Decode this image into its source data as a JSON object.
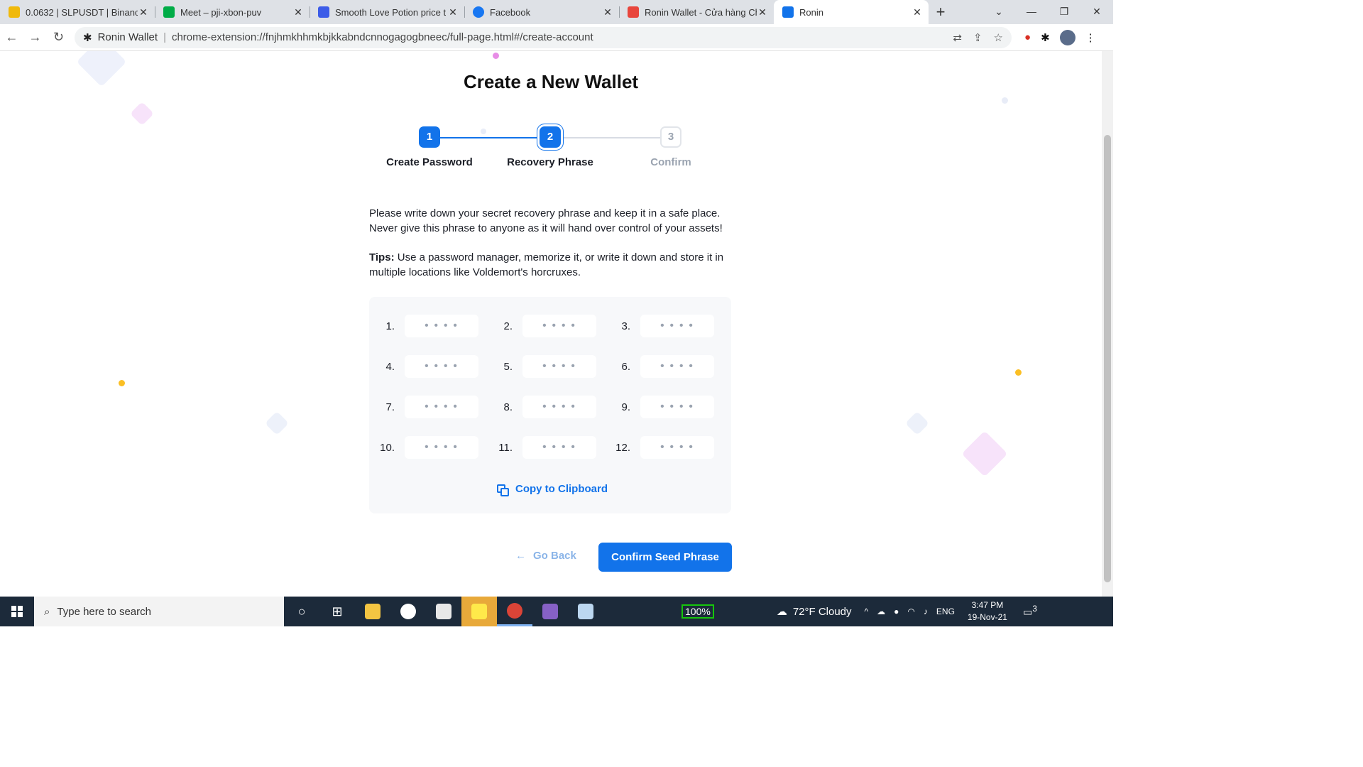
{
  "browser": {
    "tabs": [
      {
        "label": "0.0632 | SLPUSDT | Binance",
        "color": "#f0b90b"
      },
      {
        "label": "Meet – pji-xbon-puv",
        "color": "#00ac47"
      },
      {
        "label": "Smooth Love Potion price t",
        "color": "#3c5ce8"
      },
      {
        "label": "Facebook",
        "color": "#1877f2"
      },
      {
        "label": "Ronin Wallet - Cửa hàng Ch",
        "color": "#e8453c"
      },
      {
        "label": "Ronin",
        "color": "#1273ea"
      }
    ],
    "site_name": "Ronin Wallet",
    "url": "chrome-extension://fnjhmkhhmkbjkkabndcnnogagogbneec/full-page.html#/create-account"
  },
  "page": {
    "title": "Create a New Wallet",
    "steps": [
      {
        "number": "1",
        "label": "Create Password"
      },
      {
        "number": "2",
        "label": "Recovery Phrase"
      },
      {
        "number": "3",
        "label": "Confirm"
      }
    ],
    "description_line1": "Please write down your secret recovery phrase and keep it in a safe place.",
    "description_line2": "Never give this phrase to anyone as it will hand over control of your assets!",
    "tips_label": "Tips:",
    "tips_text": " Use a password manager, memorize it, or write it down and store it in multiple locations like Voldemort's horcruxes.",
    "phrase_numbers": [
      "1.",
      "2.",
      "3.",
      "4.",
      "5.",
      "6.",
      "7.",
      "8.",
      "9.",
      "10.",
      "11.",
      "12."
    ],
    "copy_label": "Copy to Clipboard",
    "back_label": "Go Back",
    "confirm_label": "Confirm Seed Phrase",
    "colors": {
      "accent": "#1273ea",
      "muted": "#9aa3b0"
    }
  },
  "taskbar": {
    "search_placeholder": "Type here to search",
    "battery": "100%",
    "weather": "72°F  Cloudy",
    "lang": "ENG",
    "time": "3:47 PM",
    "date": "19-Nov-21",
    "notif_count": "3"
  }
}
